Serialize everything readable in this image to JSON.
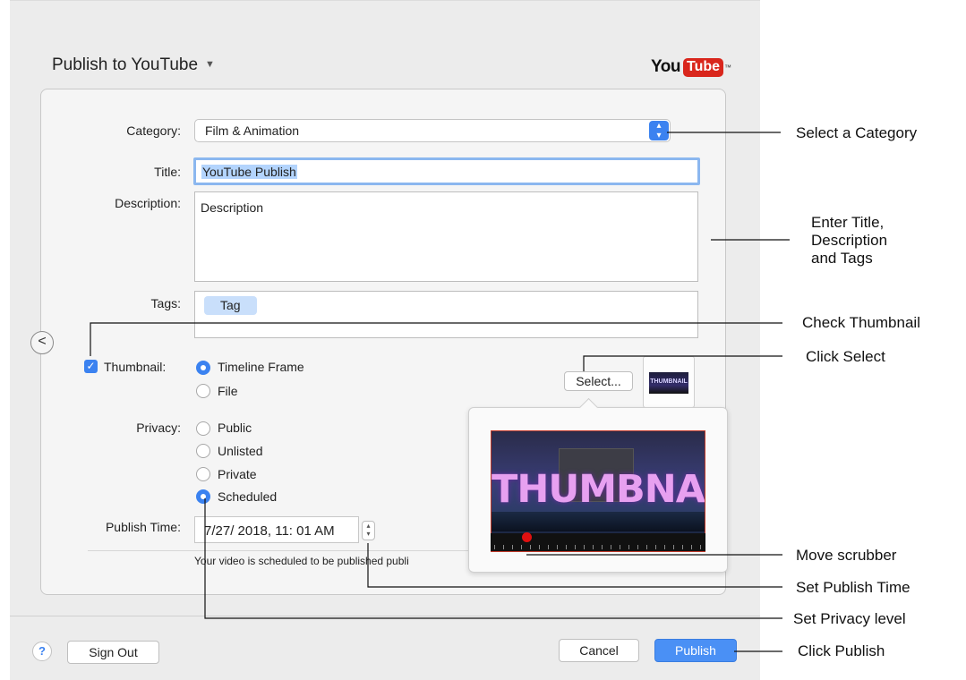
{
  "dialog": {
    "title": "Publish to YouTube",
    "logo": {
      "you": "You",
      "tube": "Tube",
      "tm": "™"
    }
  },
  "form": {
    "category_label": "Category:",
    "category_value": "Film & Animation",
    "title_label": "Title:",
    "title_value": "YouTube Publish",
    "description_label": "Description:",
    "description_value": "Description",
    "tags_label": "Tags:",
    "tags": [
      "Tag"
    ],
    "thumbnail_label": "Thumbnail:",
    "thumbnail_checked": true,
    "thumbnail_options": [
      "Timeline Frame",
      "File"
    ],
    "thumbnail_selected": "Timeline Frame",
    "select_button": "Select...",
    "thumbnail_preview_text": "THUMBNAIL",
    "privacy_label": "Privacy:",
    "privacy_options": [
      "Public",
      "Unlisted",
      "Private",
      "Scheduled"
    ],
    "privacy_selected": "Scheduled",
    "publish_time_label": "Publish Time:",
    "publish_time_value": "7/27/ 2018, 11: 01 AM",
    "schedule_note": "Your video is scheduled to be published publi"
  },
  "footer": {
    "help": "?",
    "sign_out": "Sign Out",
    "cancel": "Cancel",
    "publish": "Publish"
  },
  "callouts": {
    "category": "Select a Category",
    "title_desc_tags": [
      "Enter Title,",
      "Description",
      "and Tags"
    ],
    "check_thumbnail": "Check Thumbnail",
    "click_select": "Click Select",
    "move_scrubber": "Move scrubber",
    "set_publish_time": "Set Publish Time",
    "set_privacy": "Set Privacy level",
    "click_publish": "Click Publish"
  },
  "colors": {
    "accent": "#3b82f0",
    "youtube_red": "#d9261c",
    "scrubber": "#e01010"
  }
}
